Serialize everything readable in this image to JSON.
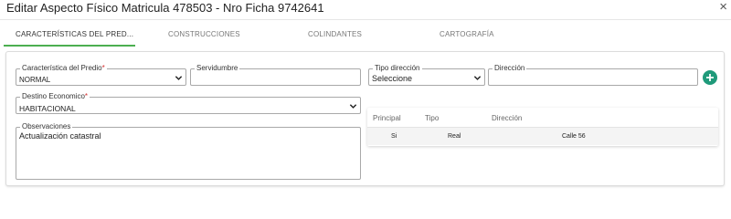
{
  "dialog": {
    "title": "Editar Aspecto Físico Matricula 478503 - Nro Ficha 9742641",
    "close_symbol": "×"
  },
  "tabs": [
    {
      "label": "CARACTERÍSTICAS DEL PRED...",
      "active": true
    },
    {
      "label": "CONSTRUCCIONES",
      "active": false
    },
    {
      "label": "COLINDANTES",
      "active": false
    },
    {
      "label": "CARTOGRAFÍA",
      "active": false
    }
  ],
  "form": {
    "caracteristica": {
      "label": "Característica del Predio",
      "required_mark": "*",
      "value": "NORMAL"
    },
    "servidumbre": {
      "label": "Servidumbre",
      "value": ""
    },
    "tipo_direccion": {
      "label": "Tipo dirección",
      "value": "Seleccione"
    },
    "direccion": {
      "label": "Dirección",
      "value": ""
    },
    "destino": {
      "label": "Destino Economico",
      "required_mark": "*",
      "value": "HABITACIONAL"
    },
    "observaciones": {
      "label": "Observaciones",
      "value": "Actualización catastral"
    }
  },
  "address_table": {
    "headers": [
      "Principal",
      "Tipo",
      "Dirección"
    ],
    "rows": [
      {
        "principal": "Si",
        "tipo": "Real",
        "direccion": "Calle 56"
      }
    ]
  },
  "colors": {
    "accent": "#4caf50",
    "add_button": "#1f9a7a",
    "required": "#d32f2f"
  },
  "icons": {
    "close": "close-icon",
    "select": "chevron-down-icon",
    "add": "plus-icon"
  }
}
